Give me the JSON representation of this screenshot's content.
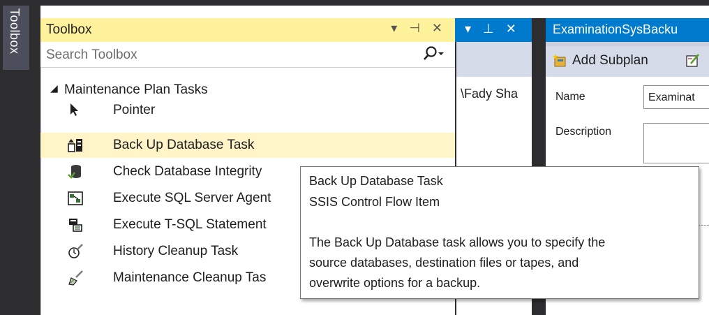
{
  "sidebar_tab": {
    "label": "Toolbox"
  },
  "toolbox": {
    "title": "Toolbox",
    "controls": "▾ ⊣ ✕",
    "search_placeholder": "Search Toolbox",
    "search_icon": "search-icon",
    "group": {
      "label": "Maintenance Plan Tasks",
      "arrow": "◢"
    },
    "items": [
      {
        "label": "Pointer",
        "icon": "pointer-icon"
      },
      {
        "label": "Back Up Database Task",
        "icon": "backup-database-icon",
        "selected": true
      },
      {
        "label": "Check Database Integrity",
        "icon": "check-integrity-icon"
      },
      {
        "label": "Execute SQL Server Agent",
        "icon": "sql-agent-icon"
      },
      {
        "label": "Execute T-SQL Statement",
        "icon": "tsql-icon"
      },
      {
        "label": "History Cleanup Task",
        "icon": "history-cleanup-icon"
      },
      {
        "label": "Maintenance Cleanup Tas",
        "icon": "maintenance-cleanup-icon"
      }
    ]
  },
  "middle_pane": {
    "header_controls": "▾ ⊥ ✕",
    "path_text": "\\Fady Sha"
  },
  "right_pane": {
    "tab_title": "ExaminationSysBacku",
    "add_subplan_label": "Add Subplan",
    "name_label": "Name",
    "name_value": "Examinat",
    "description_label": "Description"
  },
  "tooltip": {
    "title": "Back Up Database Task",
    "subtitle": "SSIS Control Flow Item",
    "line1": "The Back Up Database task allows you to specify the",
    "line2": "source databases, destination files or tapes, and",
    "line3": "overwrite options for a backup."
  },
  "colors": {
    "title_bar": "#fff29d",
    "selected_row": "#fff5c8",
    "accent": "#007acc",
    "frame": "#2d2d30"
  }
}
